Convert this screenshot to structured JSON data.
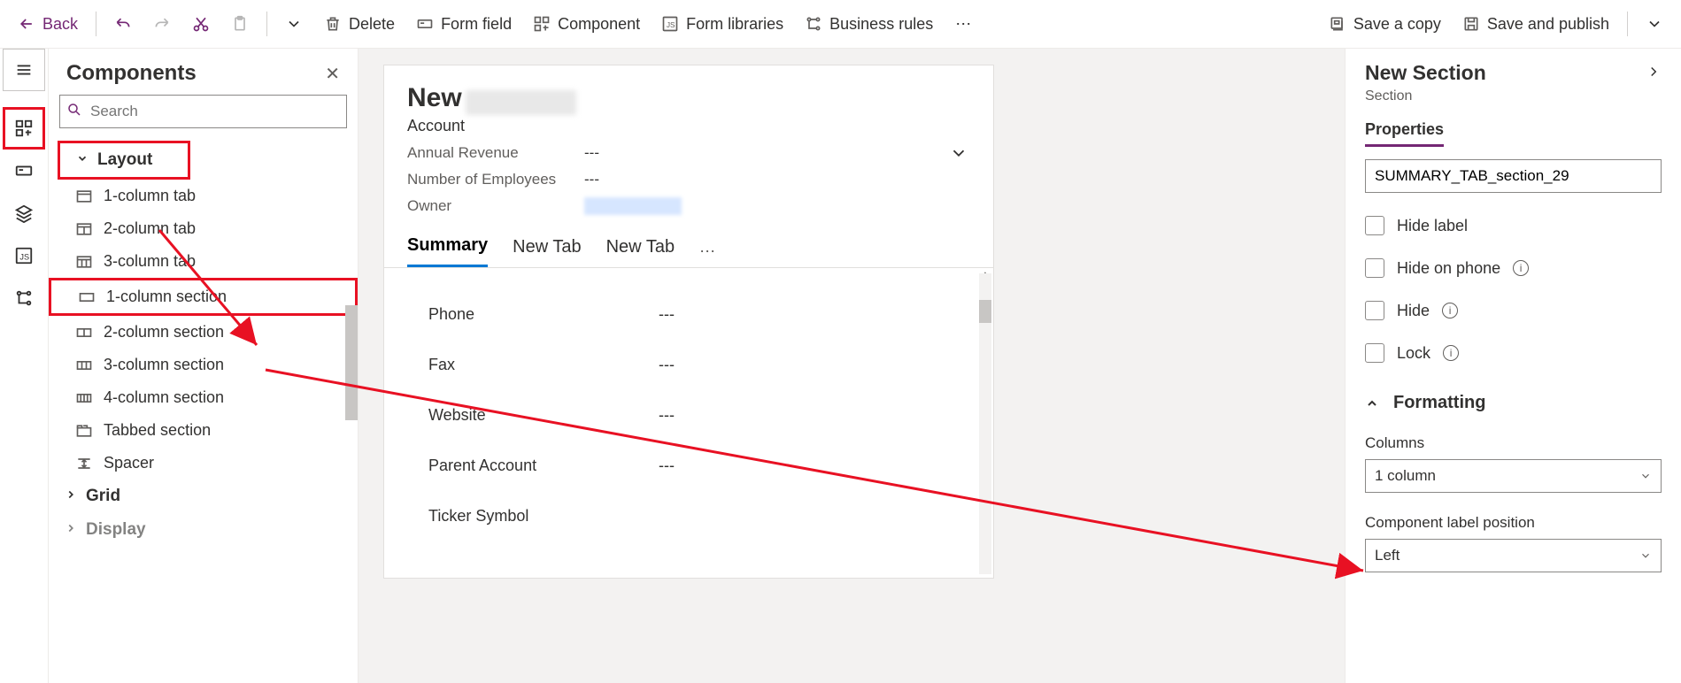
{
  "toolbar": {
    "back": "Back",
    "delete": "Delete",
    "form_field": "Form field",
    "component": "Component",
    "form_libraries": "Form libraries",
    "business_rules": "Business rules",
    "save_copy": "Save a copy",
    "save_publish": "Save and publish"
  },
  "panel": {
    "title": "Components",
    "search_placeholder": "Search",
    "groups": {
      "layout": "Layout",
      "grid": "Grid",
      "display": "Display"
    },
    "items": {
      "tab1": "1-column tab",
      "tab2": "2-column tab",
      "tab3": "3-column tab",
      "sec1": "1-column section",
      "sec2": "2-column section",
      "sec3": "3-column section",
      "sec4": "4-column section",
      "tabbed": "Tabbed section",
      "spacer": "Spacer"
    }
  },
  "form": {
    "new": "New",
    "entity": "Account",
    "fields": {
      "annual_revenue_label": "Annual Revenue",
      "annual_revenue_value": "---",
      "num_employees_label": "Number of Employees",
      "num_employees_value": "---",
      "owner_label": "Owner"
    },
    "tabs": {
      "summary": "Summary",
      "newtab1": "New Tab",
      "newtab2": "New Tab"
    },
    "rows": {
      "phone_l": "Phone",
      "phone_v": "---",
      "fax_l": "Fax",
      "fax_v": "---",
      "website_l": "Website",
      "website_v": "---",
      "parent_l": "Parent Account",
      "parent_v": "---",
      "ticker_l": "Ticker Symbol",
      "ticker_v": ""
    }
  },
  "props": {
    "title": "New Section",
    "sub": "Section",
    "tab": "Properties",
    "name_value": "SUMMARY_TAB_section_29",
    "hide_label": "Hide label",
    "hide_phone": "Hide on phone",
    "hide": "Hide",
    "lock": "Lock",
    "formatting": "Formatting",
    "columns_label": "Columns",
    "columns_value": "1 column",
    "label_pos_label": "Component label position",
    "label_pos_value": "Left"
  }
}
